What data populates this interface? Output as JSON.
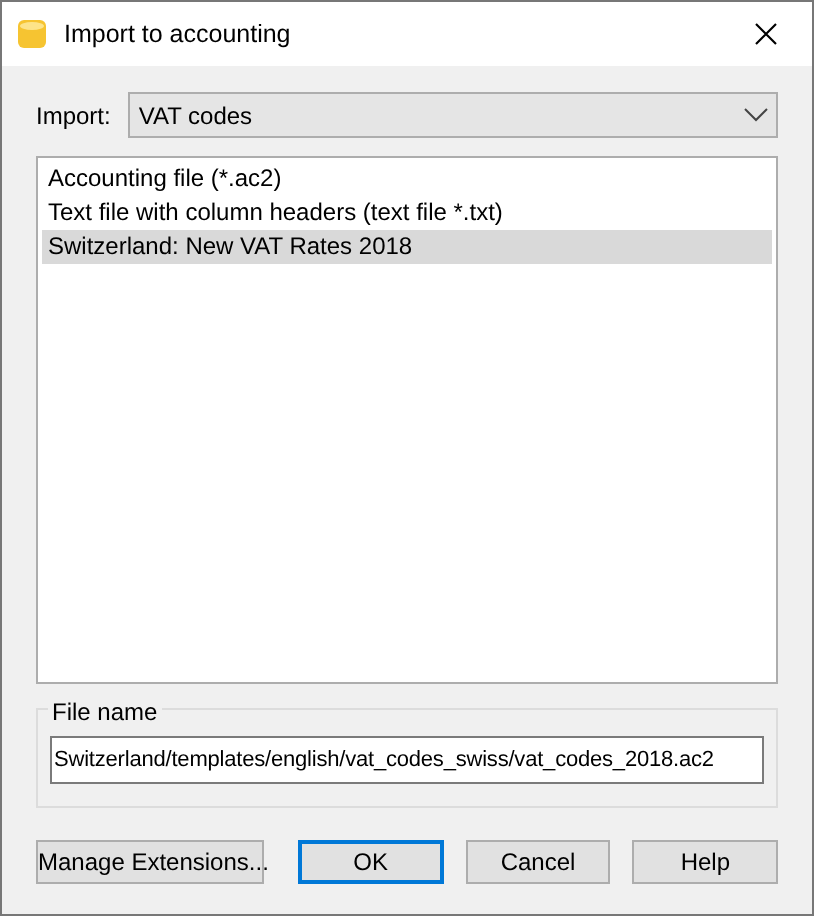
{
  "window": {
    "title": "Import to accounting"
  },
  "import": {
    "label": "Import:",
    "value": "VAT codes"
  },
  "list": [
    {
      "label": "Accounting file (*.ac2)",
      "selected": false
    },
    {
      "label": "Text file with column headers (text file *.txt)",
      "selected": false
    },
    {
      "label": "Switzerland: New VAT Rates 2018",
      "selected": true
    }
  ],
  "file_name": {
    "label": "File name",
    "value": "Switzerland/templates/english/vat_codes_swiss/vat_codes_2018.ac2"
  },
  "buttons": [
    {
      "label": "Manage Extensions...",
      "default": false
    },
    {
      "label": "OK",
      "default": true
    },
    {
      "label": "Cancel",
      "default": false
    },
    {
      "label": "Help",
      "default": false
    }
  ]
}
